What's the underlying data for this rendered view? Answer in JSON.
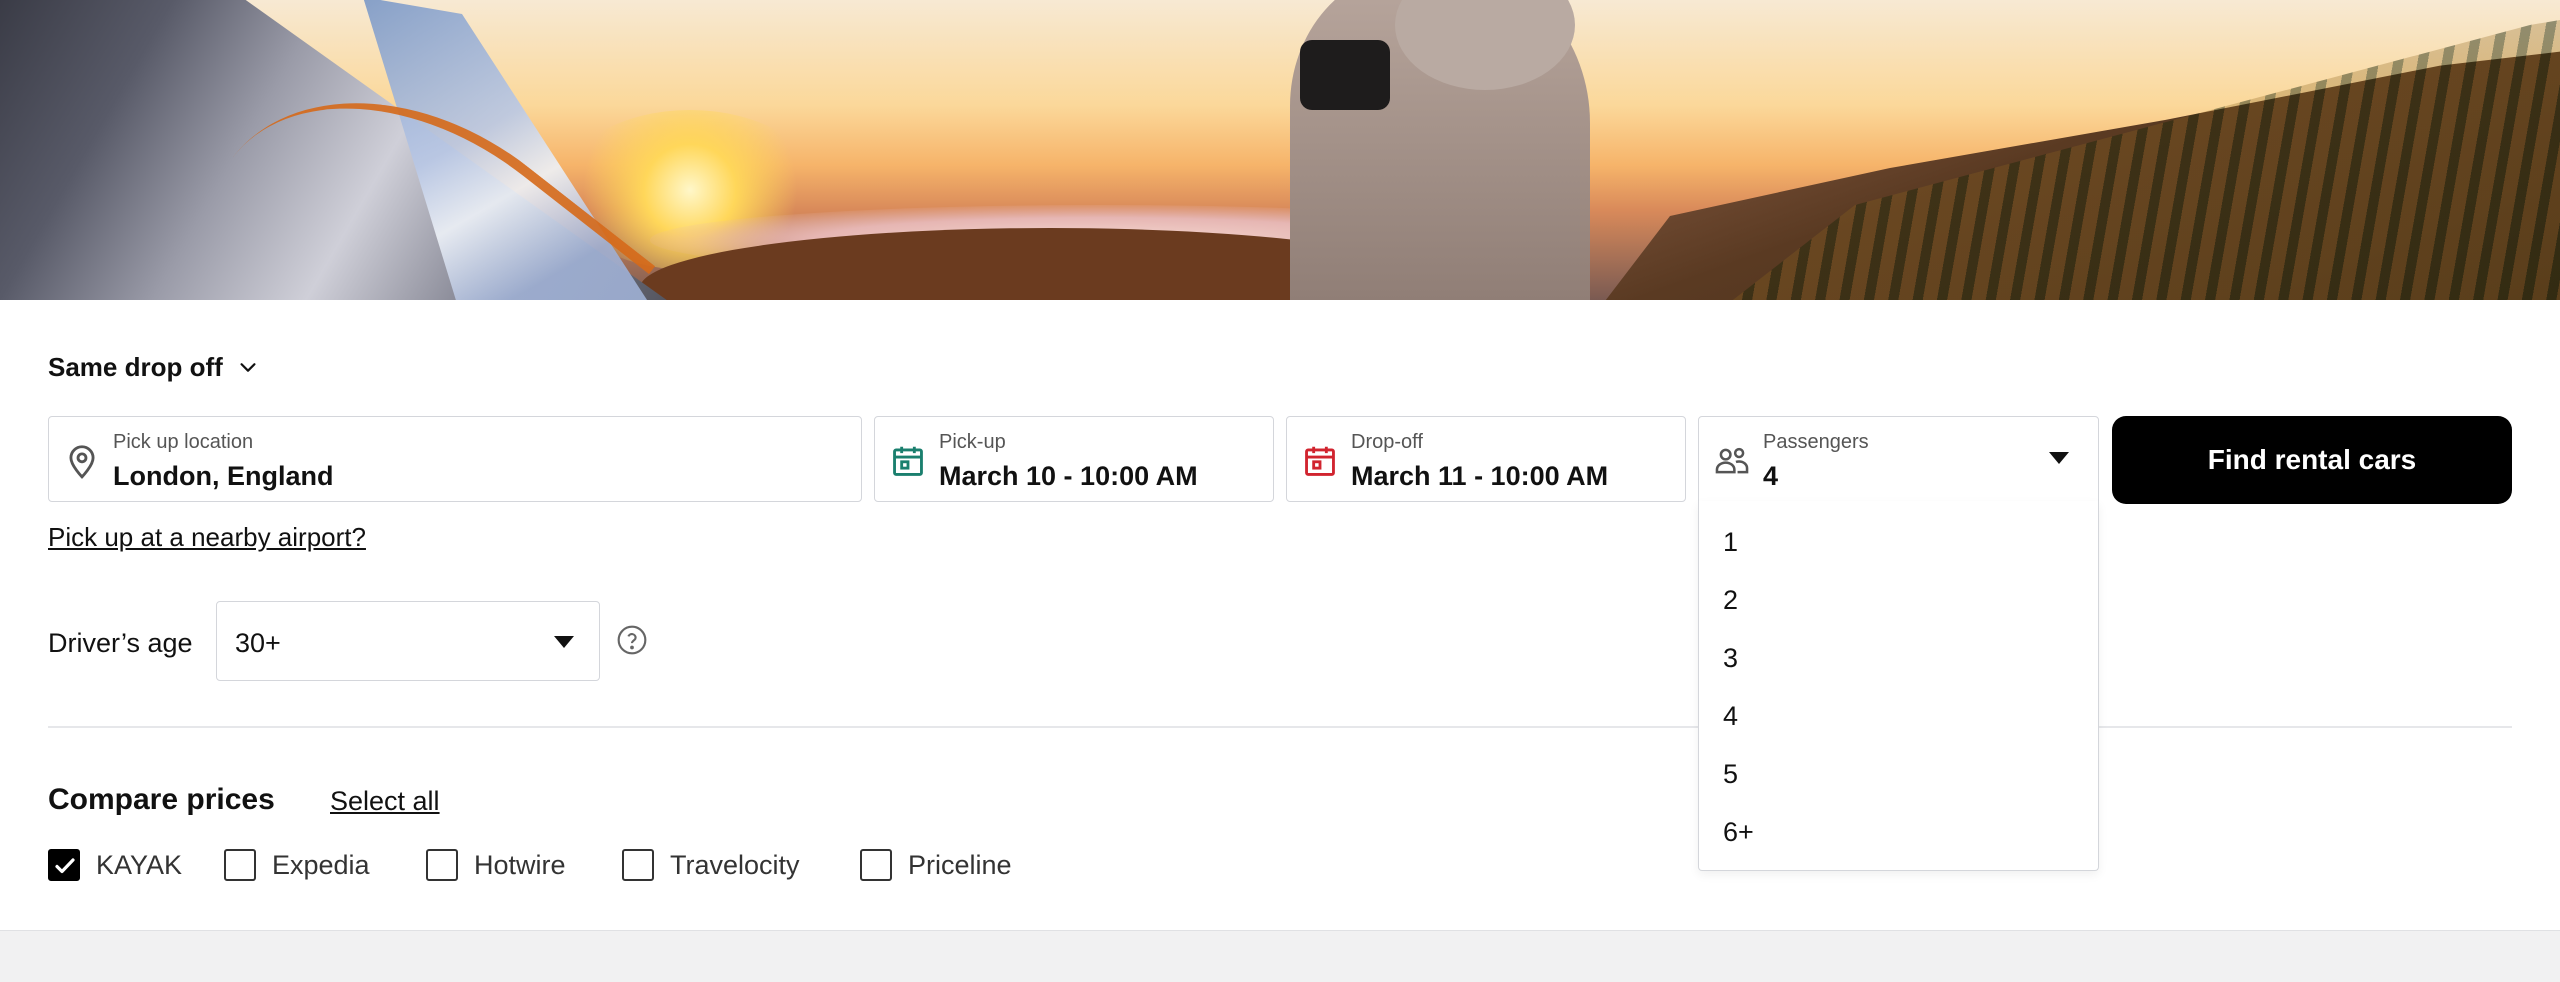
{
  "hero": {
    "alt": ""
  },
  "dropoff": {
    "label": "Same drop off"
  },
  "fields": {
    "location": {
      "label": "Pick up location",
      "value": "London, England"
    },
    "pickup": {
      "label": "Pick-up",
      "value": "March 10 - 10:00 AM"
    },
    "dropoff": {
      "label": "Drop-off",
      "value": "March 11 - 10:00 AM"
    },
    "passengers": {
      "label": "Passengers",
      "value": "4",
      "options": [
        "1",
        "2",
        "3",
        "4",
        "5",
        "6+"
      ]
    }
  },
  "find_button": {
    "label": "Find rental cars"
  },
  "airport_link": {
    "label": "Pick up at a nearby airport?"
  },
  "driver_age": {
    "label": "Driver’s age",
    "value": "30+"
  },
  "compare": {
    "title": "Compare prices",
    "select_all": "Select all",
    "providers": [
      {
        "label": "KAYAK",
        "checked": true
      },
      {
        "label": "Expedia",
        "checked": false
      },
      {
        "label": "Hotwire",
        "checked": false
      },
      {
        "label": "Travelocity",
        "checked": false
      },
      {
        "label": "Priceline",
        "checked": false
      }
    ]
  },
  "colors": {
    "pickup_icon": "#1a7f6e",
    "dropoff_icon": "#d1242f",
    "button_bg": "#000000"
  },
  "icons": {
    "location": "location-pin-icon",
    "pickup": "calendar-icon",
    "dropoff": "calendar-icon",
    "passengers": "people-icon",
    "help": "question-circle-icon"
  }
}
